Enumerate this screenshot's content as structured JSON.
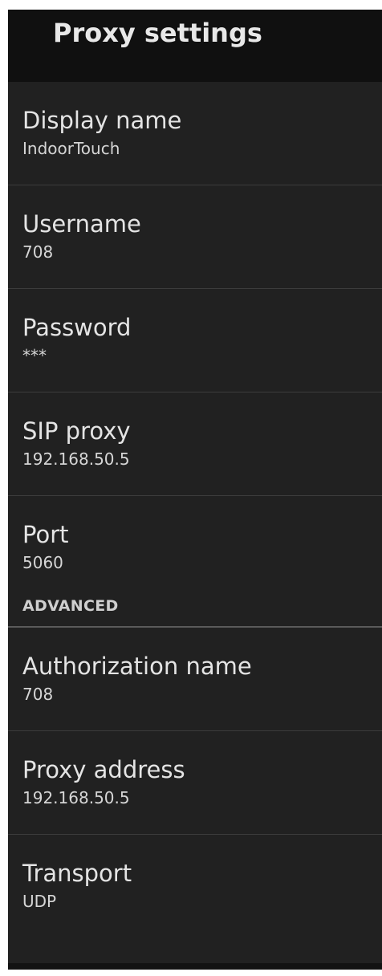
{
  "action_bar": {
    "title": "Proxy settings"
  },
  "preferences": [
    {
      "title": "Display name",
      "summary": "IndoorTouch"
    },
    {
      "title": "Username",
      "summary": "708"
    },
    {
      "title": "Password",
      "summary": "***"
    },
    {
      "title": "SIP proxy",
      "summary": "192.168.50.5"
    },
    {
      "title": "Port",
      "summary": "5060"
    }
  ],
  "advanced": {
    "header": "ADVANCED",
    "items": [
      {
        "title": "Authorization name",
        "summary": "708"
      },
      {
        "title": "Proxy address",
        "summary": "192.168.50.5"
      },
      {
        "title": "Transport",
        "summary": "UDP"
      }
    ]
  },
  "colors": {
    "background": "#212121",
    "action_bar": "#101010",
    "divider": "#3c3c3c",
    "text_primary": "#e4e4e4"
  }
}
